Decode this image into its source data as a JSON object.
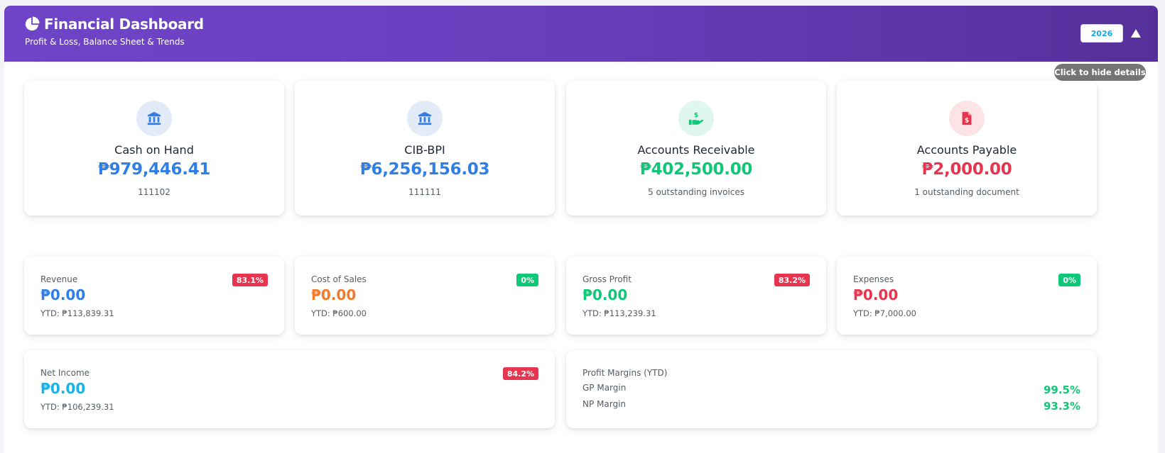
{
  "header": {
    "title": "Financial Dashboard",
    "subtitle": "Profit & Loss, Balance Sheet & Trends",
    "year": "2026",
    "tooltip": "Click to hide details"
  },
  "accounts": [
    {
      "name": "Cash on Hand",
      "amount": "₱979,446.41",
      "sub": "111102",
      "icon": "bank-icon",
      "color": "#2f7fe6"
    },
    {
      "name": "CIB-BPI",
      "amount": "₱6,256,156.03",
      "sub": "111111",
      "icon": "bank-icon",
      "color": "#2f7fe6"
    },
    {
      "name": "Accounts Receivable",
      "amount": "₱402,500.00",
      "sub": "5 outstanding invoices",
      "icon": "hand-dollar-icon",
      "color": "#0ec877"
    },
    {
      "name": "Accounts Payable",
      "amount": "₱2,000.00",
      "sub": "1 outstanding document",
      "icon": "invoice-dollar-icon",
      "color": "#e7344f"
    }
  ],
  "metrics": [
    {
      "label": "Revenue",
      "value": "₱0.00",
      "ytd": "YTD: ₱113,839.31",
      "badge": "83.1%",
      "badge_color": "red",
      "color": "#2f7fe6"
    },
    {
      "label": "Cost of Sales",
      "value": "₱0.00",
      "ytd": "YTD: ₱600.00",
      "badge": "0%",
      "badge_color": "green",
      "color": "#f37a2a"
    },
    {
      "label": "Gross Profit",
      "value": "₱0.00",
      "ytd": "YTD: ₱113,239.31",
      "badge": "83.2%",
      "badge_color": "red",
      "color": "#0ec877"
    },
    {
      "label": "Expenses",
      "value": "₱0.00",
      "ytd": "YTD: ₱7,000.00",
      "badge": "0%",
      "badge_color": "green",
      "color": "#e7344f"
    }
  ],
  "net_income": {
    "label": "Net Income",
    "value": "₱0.00",
    "ytd": "YTD: ₱106,239.31",
    "badge": "84.2%",
    "color": "#1ab0e8"
  },
  "margins": {
    "title": "Profit Margins (YTD)",
    "gp_label": "GP Margin",
    "gp_value": "99.5%",
    "np_label": "NP Margin",
    "np_value": "93.3%"
  }
}
